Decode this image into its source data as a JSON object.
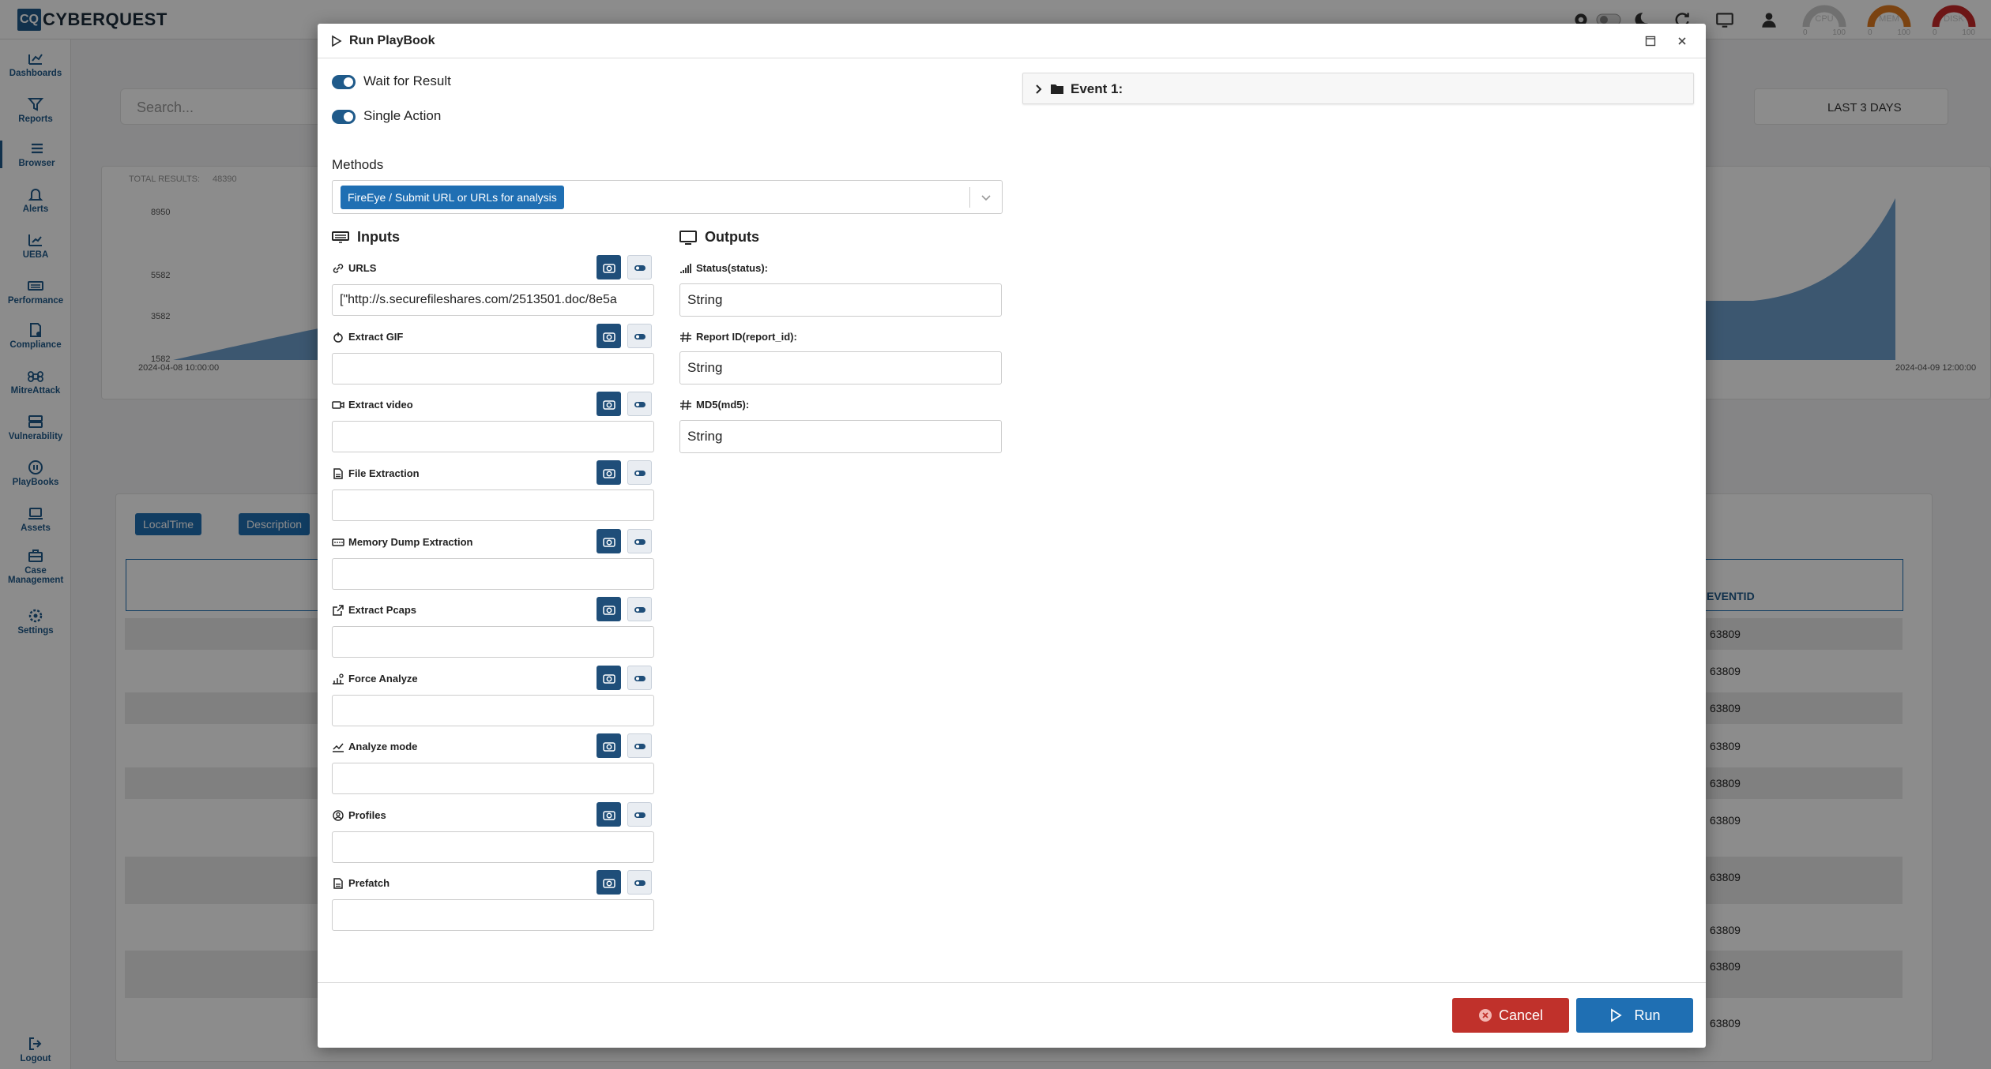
{
  "app": {
    "logo_mark": "CQ",
    "logo_text": "CYBERQUEST"
  },
  "gauges": [
    {
      "label": "CPU",
      "min": "0",
      "max": "100"
    },
    {
      "label": "MEM",
      "min": "0",
      "max": "100"
    },
    {
      "label": "DISK",
      "min": "0",
      "max": "100"
    }
  ],
  "sidebar": {
    "items": [
      {
        "label": "Dashboards"
      },
      {
        "label": "Reports"
      },
      {
        "label": "Browser"
      },
      {
        "label": "Alerts"
      },
      {
        "label": "UEBA"
      },
      {
        "label": "Performance"
      },
      {
        "label": "Compliance"
      },
      {
        "label": "MitreAttack"
      },
      {
        "label": "Vulnerability"
      },
      {
        "label": "PlayBooks"
      },
      {
        "label": "Assets"
      },
      {
        "label": "Case Management"
      },
      {
        "label": "Settings"
      }
    ],
    "logout": "Logout"
  },
  "background": {
    "search_placeholder": "Search...",
    "time_range": "LAST 3 DAYS",
    "total_results_label": "TOTAL RESULTS:",
    "total_results_value": "48390",
    "y_ticks": [
      "8950",
      "5582",
      "3582",
      "1582"
    ],
    "x_tick_start": "2024-04-08 10:00:00",
    "x_tick_end": "2024-04-09 12:00:00",
    "filter_chips": [
      "LocalTime",
      "Description"
    ],
    "column_header": "EVENTID",
    "row_values": [
      "63809",
      "63809",
      "63809",
      "63809",
      "63809",
      "63809",
      "63809",
      "63809",
      "63809",
      "63809"
    ]
  },
  "modal": {
    "title": "Run PlayBook",
    "wait_for_result": "Wait for Result",
    "single_action": "Single Action",
    "methods_label": "Methods",
    "method_selected": "FireEye / Submit URL or URLs for analysis",
    "inputs_title": "Inputs",
    "outputs_title": "Outputs",
    "inputs": [
      {
        "label": "URLS",
        "value": "[\"http://s.securefileshares.com/2513501.doc/8e5a"
      },
      {
        "label": "Extract GIF",
        "value": ""
      },
      {
        "label": "Extract video",
        "value": ""
      },
      {
        "label": "File Extraction",
        "value": ""
      },
      {
        "label": "Memory Dump Extraction",
        "value": ""
      },
      {
        "label": "Extract Pcaps",
        "value": ""
      },
      {
        "label": "Force Analyze",
        "value": ""
      },
      {
        "label": "Analyze mode",
        "value": ""
      },
      {
        "label": "Profiles",
        "value": ""
      },
      {
        "label": "Prefatch",
        "value": ""
      }
    ],
    "outputs": [
      {
        "label": "Status(status):",
        "value": "String"
      },
      {
        "label": "Report ID(report_id):",
        "value": "String"
      },
      {
        "label": "MD5(md5):",
        "value": "String"
      }
    ],
    "event_label": "Event 1:",
    "cancel": "Cancel",
    "run": "Run"
  }
}
